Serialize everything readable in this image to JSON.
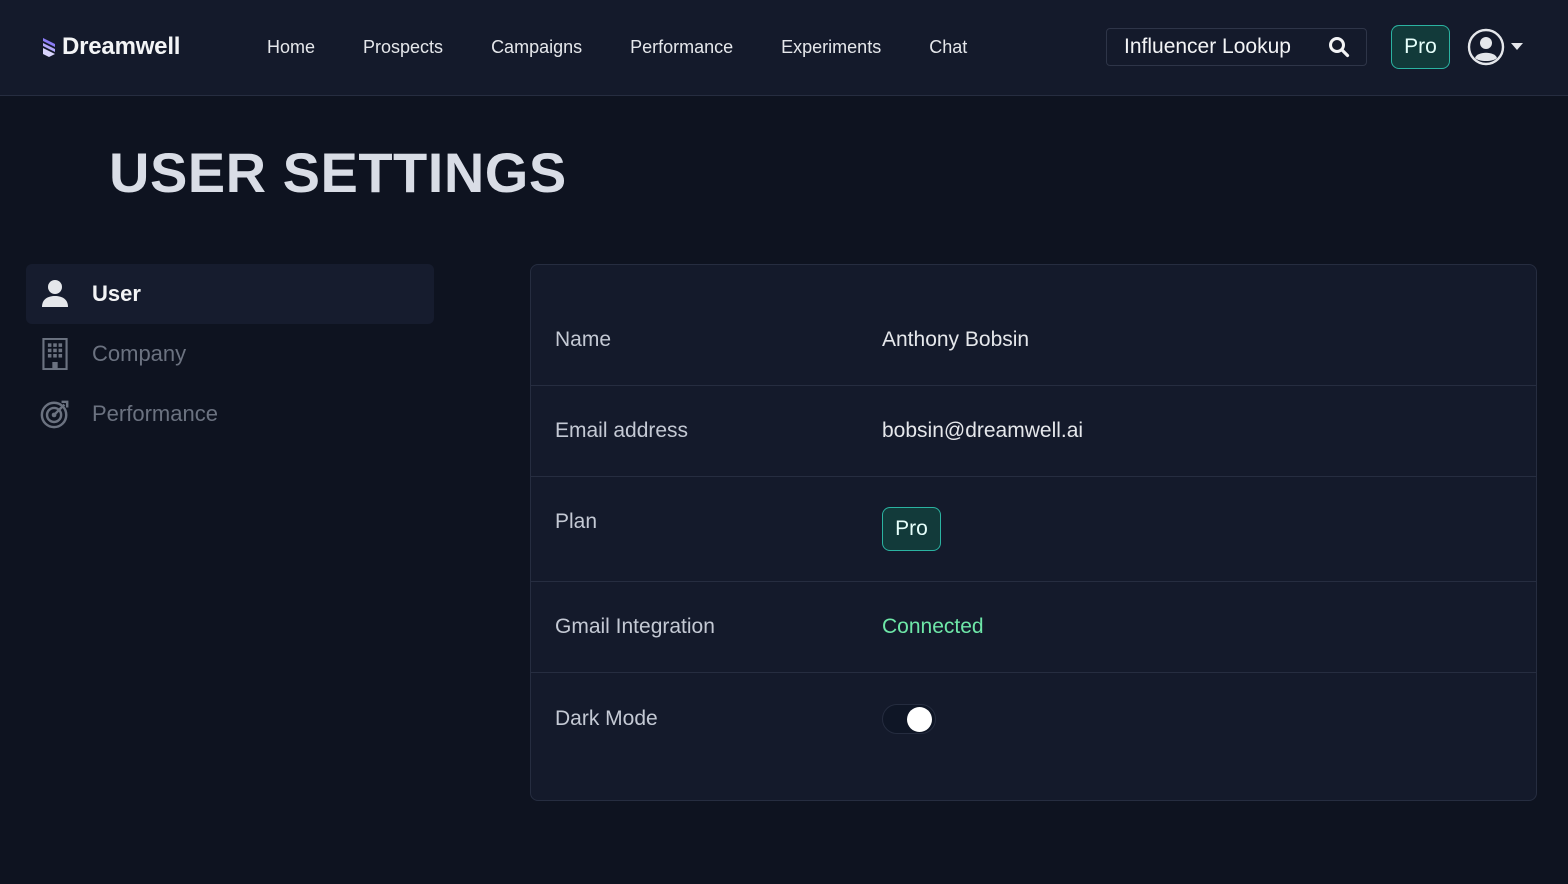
{
  "brand": {
    "name": "Dreamwell"
  },
  "nav": {
    "items": [
      {
        "label": "Home"
      },
      {
        "label": "Prospects"
      },
      {
        "label": "Campaigns"
      },
      {
        "label": "Performance"
      },
      {
        "label": "Experiments"
      },
      {
        "label": "Chat"
      }
    ]
  },
  "lookup": {
    "label": "Influencer Lookup",
    "icon": "search-icon"
  },
  "header": {
    "plan_badge": "Pro",
    "avatar_icon": "user-circle-icon",
    "caret_icon": "caret-down-icon"
  },
  "page": {
    "title": "USER SETTINGS"
  },
  "sidebar": {
    "items": [
      {
        "label": "User",
        "icon": "user-icon",
        "active": true
      },
      {
        "label": "Company",
        "icon": "building-icon",
        "active": false
      },
      {
        "label": "Performance",
        "icon": "target-icon",
        "active": false
      }
    ]
  },
  "settings": {
    "name": {
      "label": "Name",
      "value": "Anthony Bobsin"
    },
    "email": {
      "label": "Email address",
      "value": "bobsin@dreamwell.ai"
    },
    "plan": {
      "label": "Plan",
      "value": "Pro"
    },
    "gmail": {
      "label": "Gmail Integration",
      "value": "Connected"
    },
    "dark_mode": {
      "label": "Dark Mode",
      "enabled": true
    }
  },
  "colors": {
    "background": "#0e1320",
    "surface": "#141a2b",
    "accent_teal": "#2bb3a1",
    "connected_green": "#6ee7a8"
  }
}
